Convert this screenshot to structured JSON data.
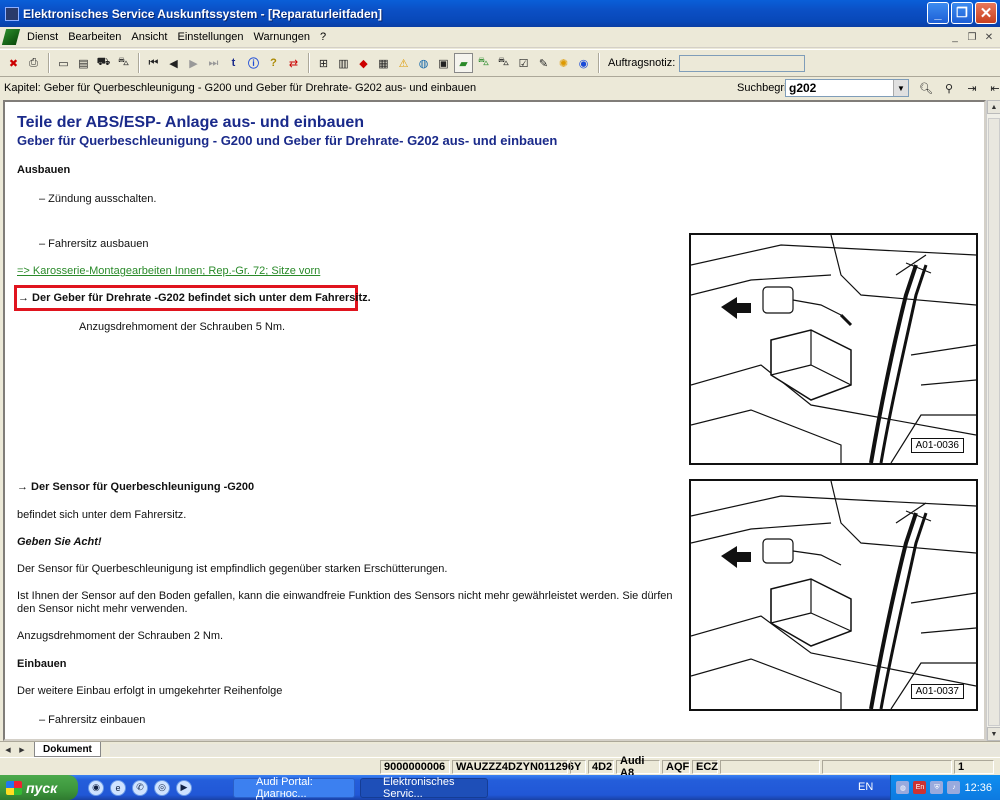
{
  "window": {
    "title": "Elektronisches Service Auskunftssystem - [Reparaturleitfaden]"
  },
  "menu": {
    "items": [
      "Dienst",
      "Bearbeiten",
      "Ansicht",
      "Einstellungen",
      "Warnungen",
      "?"
    ]
  },
  "toolbar": {
    "order_note_label": "Auftragsnotiz:",
    "order_note_value": "",
    "icons": [
      "exit-icon",
      "print-icon",
      "new-document-icon",
      "document-icon",
      "vehicle-icon",
      "car-icon",
      "first-page-icon",
      "previous-page-icon",
      "next-page-icon",
      "last-page-icon",
      "back-to-top-icon",
      "info-icon",
      "hint-icon",
      "swap-icon",
      "exploded-view-icon",
      "book-icon",
      "red-book-icon",
      "text-document-icon",
      "warning-icon",
      "globe-icon",
      "save-icon",
      "repair-guide-icon",
      "car-green-icon",
      "car-dark-icon",
      "checklist-icon",
      "edit-icon",
      "bulb-icon",
      "network-icon"
    ]
  },
  "chapter": {
    "text": "Kapitel: Geber für Querbeschleunigung - G200 und Geber für Drehrate- G202 aus- und einbauen",
    "search_label": "Suchbegriff:",
    "search_value": "g202"
  },
  "document": {
    "title": "Teile der ABS/ESP- Anlage aus- und einbauen",
    "subtitle": "Geber für Querbeschleunigung - G200 und Geber für Drehrate- G202 aus- und einbauen",
    "section_remove": "Ausbauen",
    "step1": "– Zündung ausschalten.",
    "step2": "– Fahrersitz ausbauen",
    "link1": "=> Karosserie-Montagearbeiten Innen; Rep.-Gr. 72; Sitze vorn",
    "highlight": "→ Der Geber für Drehrate -G202 befindet sich unter dem Fahrersitz.",
    "torque1": "Anzugsdrehmoment der Schrauben 5 Nm.",
    "sensor_heading": "→ Der Sensor für Querbeschleunigung -G200",
    "sensor_location": "befindet sich unter dem Fahrersitz.",
    "caution_title": "Geben Sie Acht!",
    "caution_text": "Der Sensor für Querbeschleunigung ist empfindlich gegenüber starken Erschütterungen.",
    "drop_text": "Ist Ihnen der Sensor auf den Boden gefallen, kann die einwandfreie Funktion des Sensors nicht mehr gewährleistet werden. Sie dürfen den Sensor nicht mehr verwenden.",
    "torque2": "Anzugsdrehmoment der Schrauben 2 Nm.",
    "section_install": "Einbauen",
    "install_text": "Der weitere Einbau erfolgt in umgekehrter Reihenfolge",
    "step3": "– Fahrersitz einbauen",
    "figure1_label": "A01-0036",
    "figure2_label": "A01-0037"
  },
  "tabs": {
    "document": "Dokument"
  },
  "status": {
    "seg1": "9000000006",
    "seg2": "WAUZZZ4DZYN011296",
    "seg3": "Y",
    "seg4": "4D2",
    "seg5": "Audi A8",
    "seg6": "AQF",
    "seg7": "ECZ",
    "seg8": "1"
  },
  "taskbar": {
    "start": "пуск",
    "task1": "Audi Portal: Диагнос...",
    "task2": "Elektronisches Servic...",
    "lang": "EN",
    "clock": "12:36"
  },
  "colors": {
    "heading": "#1a2a8a",
    "link": "#2a8a2a",
    "highlight_border": "#e0141e"
  }
}
